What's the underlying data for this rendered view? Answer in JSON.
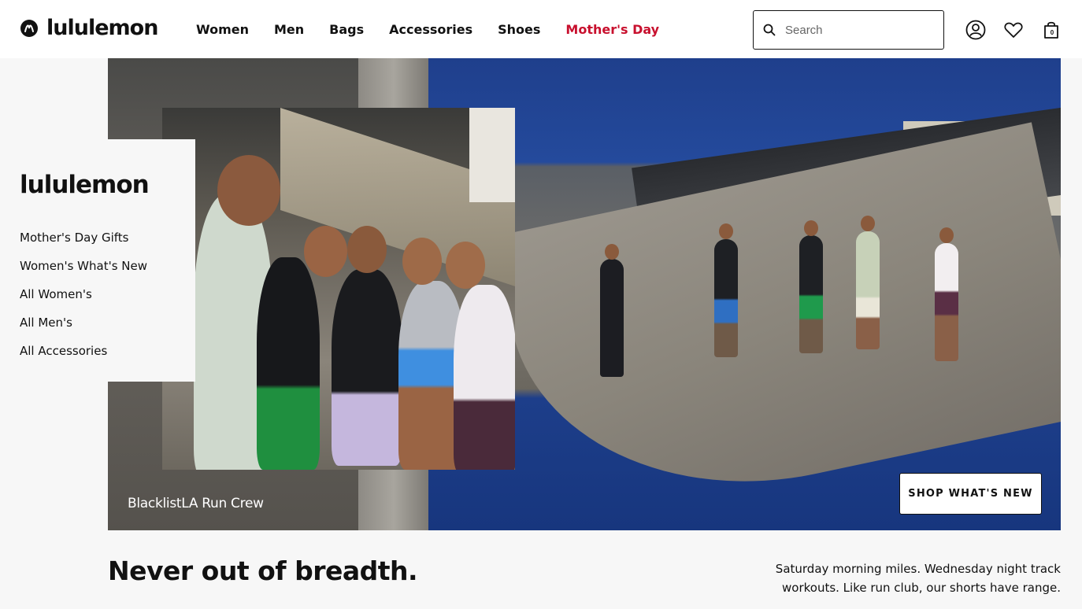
{
  "brand": {
    "name": "lululemon",
    "logo_icon": "lululemon-logo-icon"
  },
  "nav": {
    "items": [
      {
        "label": "Women"
      },
      {
        "label": "Men"
      },
      {
        "label": "Bags"
      },
      {
        "label": "Accessories"
      },
      {
        "label": "Shoes"
      },
      {
        "label": "Mother's Day",
        "accent": "#c8102e"
      }
    ]
  },
  "search": {
    "placeholder": "Search",
    "icon": "search-icon"
  },
  "header_icons": {
    "account": "account-icon",
    "wishlist": "heart-icon",
    "bag": "shopping-bag-icon",
    "bag_count": "0"
  },
  "side_menu": {
    "title": "lululemon",
    "links": [
      {
        "label": "Mother's Day Gifts"
      },
      {
        "label": "Women's What's New"
      },
      {
        "label": "All Women's"
      },
      {
        "label": "All Men's"
      },
      {
        "label": "All Accessories"
      }
    ]
  },
  "hero": {
    "caption": "BlacklistLA Run Crew",
    "cta_label": "SHOP WHAT'S NEW"
  },
  "promo": {
    "headline": "Never out of breadth.",
    "subcopy": "Saturday morning miles. Wednesday night track workouts. Like run club, our shorts have range."
  },
  "colors": {
    "accent": "#c8102e",
    "text": "#111111",
    "background": "#f7f7f7"
  }
}
